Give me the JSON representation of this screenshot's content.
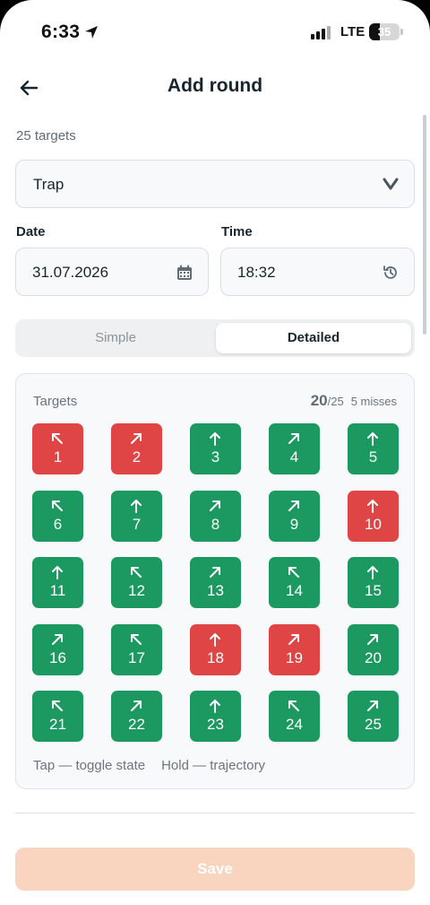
{
  "status_bar": {
    "time": "6:33",
    "network": "LTE",
    "battery": "35",
    "battery_level": 0.35
  },
  "header": {
    "title": "Add round",
    "back_icon": "arrow-left-icon"
  },
  "round": {
    "targets_count": "25 targets",
    "discipline": "Trap",
    "date_label": "Date",
    "date_value": "31.07.2026",
    "time_label": "Time",
    "time_value": "18:32"
  },
  "mode_toggle": {
    "options": [
      "Simple",
      "Detailed"
    ],
    "selected": "Detailed"
  },
  "targets_card": {
    "title": "Targets",
    "score": "20",
    "score_total": "/25",
    "misses": "5 misses",
    "hint_tap": "Tap — toggle state",
    "hint_hold": "Hold — trajectory",
    "targets": [
      {
        "number": "1",
        "state": "miss",
        "direction": "left"
      },
      {
        "number": "2",
        "state": "miss",
        "direction": "right"
      },
      {
        "number": "3",
        "state": "hit",
        "direction": "straight"
      },
      {
        "number": "4",
        "state": "hit",
        "direction": "right"
      },
      {
        "number": "5",
        "state": "hit",
        "direction": "straight"
      },
      {
        "number": "6",
        "state": "hit",
        "direction": "left"
      },
      {
        "number": "7",
        "state": "hit",
        "direction": "straight"
      },
      {
        "number": "8",
        "state": "hit",
        "direction": "right"
      },
      {
        "number": "9",
        "state": "hit",
        "direction": "right"
      },
      {
        "number": "10",
        "state": "miss",
        "direction": "straight"
      },
      {
        "number": "11",
        "state": "hit",
        "direction": "straight"
      },
      {
        "number": "12",
        "state": "hit",
        "direction": "left"
      },
      {
        "number": "13",
        "state": "hit",
        "direction": "right"
      },
      {
        "number": "14",
        "state": "hit",
        "direction": "left"
      },
      {
        "number": "15",
        "state": "hit",
        "direction": "straight"
      },
      {
        "number": "16",
        "state": "hit",
        "direction": "right"
      },
      {
        "number": "17",
        "state": "hit",
        "direction": "left"
      },
      {
        "number": "18",
        "state": "miss",
        "direction": "straight"
      },
      {
        "number": "19",
        "state": "miss",
        "direction": "right"
      },
      {
        "number": "20",
        "state": "hit",
        "direction": "right"
      },
      {
        "number": "21",
        "state": "hit",
        "direction": "left"
      },
      {
        "number": "22",
        "state": "hit",
        "direction": "right"
      },
      {
        "number": "23",
        "state": "hit",
        "direction": "straight"
      },
      {
        "number": "24",
        "state": "hit",
        "direction": "left"
      },
      {
        "number": "25",
        "state": "hit",
        "direction": "right"
      }
    ]
  },
  "footer": {
    "save_label": "Save"
  },
  "colors": {
    "hit": "#1b9960",
    "miss": "#e04545",
    "save_disabled": "#f9d5bf"
  }
}
